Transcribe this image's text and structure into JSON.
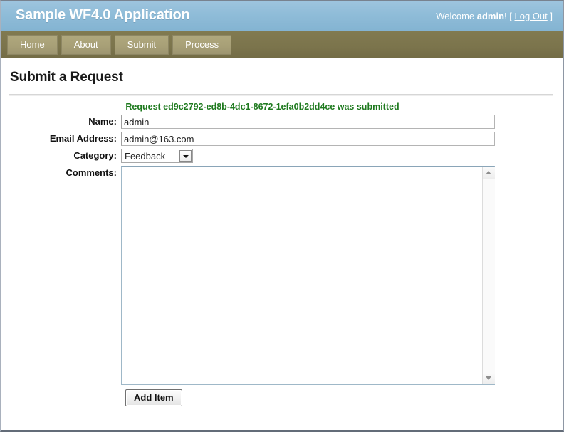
{
  "banner": {
    "app_title": "Sample WF4.0 Application",
    "welcome_prefix": "Welcome ",
    "user_name": "admin",
    "welcome_suffix": "! [ ",
    "logout_label": "Log Out",
    "welcome_end": " ]"
  },
  "nav": {
    "items": [
      {
        "label": "Home"
      },
      {
        "label": "About"
      },
      {
        "label": "Submit"
      },
      {
        "label": "Process"
      }
    ]
  },
  "page": {
    "title": "Submit a Request",
    "status_message": "Request ed9c2792-ed8b-4dc1-8672-1efa0b2dd4ce was submitted"
  },
  "form": {
    "name": {
      "label": "Name:",
      "value": "admin",
      "placeholder": ""
    },
    "email": {
      "label": "Email Address:",
      "value": "admin@163.com",
      "placeholder": ""
    },
    "category": {
      "label": "Category:",
      "value": "Feedback",
      "options": [
        "Feedback"
      ]
    },
    "comments": {
      "label": "Comments:",
      "value": "",
      "placeholder": ""
    },
    "submit_button": "Add Item"
  },
  "icons": {
    "select_arrow": "chevron-down-icon",
    "scroll_up": "scroll-up-arrow-icon",
    "scroll_down": "scroll-down-arrow-icon"
  },
  "colors": {
    "banner_blue": "#8fbcd8",
    "nav_olive": "#7b744c",
    "nav_button": "#a8a077",
    "status_green": "#1f7a1f"
  }
}
